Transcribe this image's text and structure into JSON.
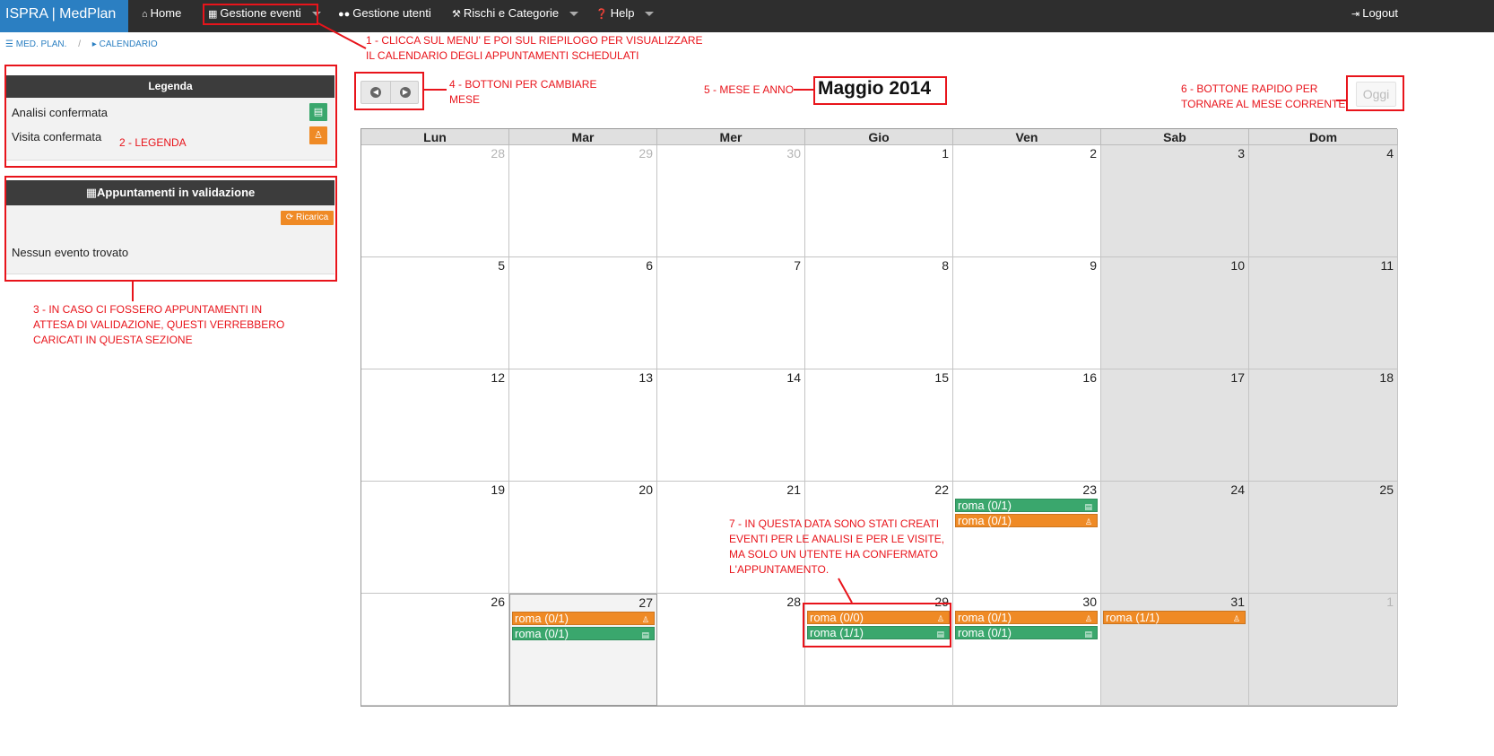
{
  "colors": {
    "brand": "#2b7fc2",
    "navbar": "#2e2e2e",
    "analisi": "#3aa76d",
    "visita": "#ef8a25",
    "annotation": "#e8141b"
  },
  "navbar": {
    "brand": "ISPRA | MedPlan",
    "items": [
      {
        "label": "Home",
        "icon": "home-icon"
      },
      {
        "label": "Gestione eventi",
        "icon": "calendar-icon",
        "dropdown": true
      },
      {
        "label": "Gestione utenti",
        "icon": "users-icon"
      },
      {
        "label": "Rischi e Categorie",
        "icon": "wrench-icon",
        "dropdown": true
      },
      {
        "label": "Help",
        "icon": "question-icon",
        "dropdown": true
      }
    ],
    "logout": "Logout"
  },
  "breadcrumb": {
    "root": "MED. PLAN.",
    "current": "CALENDARIO"
  },
  "legend": {
    "title": "Legenda",
    "items": [
      {
        "label": "Analisi confermata",
        "icon": "clipboard-icon"
      },
      {
        "label": "Visita confermata",
        "icon": "user-md-icon"
      }
    ]
  },
  "validation": {
    "title": "Appuntamenti in validazione",
    "reload": "Ricarica",
    "empty": "Nessun evento trovato"
  },
  "calendar": {
    "month_title": "Maggio 2014",
    "today_label": "Oggi",
    "weekdays": [
      "Lun",
      "Mar",
      "Mer",
      "Gio",
      "Ven",
      "Sab",
      "Dom"
    ],
    "weeks": [
      [
        "28",
        "29",
        "30",
        "1",
        "2",
        "3",
        "4"
      ],
      [
        "5",
        "6",
        "7",
        "8",
        "9",
        "10",
        "11"
      ],
      [
        "12",
        "13",
        "14",
        "15",
        "16",
        "17",
        "18"
      ],
      [
        "19",
        "20",
        "21",
        "22",
        "23",
        "24",
        "25"
      ],
      [
        "26",
        "27",
        "28",
        "29",
        "30",
        "31",
        "1"
      ]
    ],
    "events": {
      "23": [
        {
          "label": "roma (0/1)",
          "type": "analisi"
        },
        {
          "label": "roma (0/1)",
          "type": "visita"
        }
      ],
      "27": [
        {
          "label": "roma (0/1)",
          "type": "visita"
        },
        {
          "label": "roma (0/1)",
          "type": "analisi"
        }
      ],
      "29": [
        {
          "label": "roma (0/0)",
          "type": "visita"
        },
        {
          "label": "roma (1/1)",
          "type": "analisi"
        }
      ],
      "30": [
        {
          "label": "roma (0/1)",
          "type": "visita"
        },
        {
          "label": "roma (0/1)",
          "type": "analisi"
        }
      ],
      "31": [
        {
          "label": "roma (1/1)",
          "type": "visita"
        }
      ]
    }
  },
  "annotations": {
    "a1": [
      "1 - CLICCA SUL MENU' E POI SUL RIEPILOGO PER VISUALIZZARE",
      "IL CALENDARIO DEGLI APPUNTAMENTI SCHEDULATI"
    ],
    "a2": "2 - LEGENDA",
    "a3": [
      "3 - IN CASO CI FOSSERO APPUNTAMENTI IN",
      "ATTESA DI VALIDAZIONE, QUESTI VERREBBERO",
      "CARICATI IN QUESTA SEZIONE"
    ],
    "a4": [
      "4 - BOTTONI PER CAMBIARE",
      "MESE"
    ],
    "a5": "5 - MESE E ANNO",
    "a6": [
      "6 - BOTTONE RAPIDO PER",
      "TORNARE AL MESE CORRENTE"
    ],
    "a7": [
      "7 - IN QUESTA DATA SONO STATI CREATI",
      "EVENTI PER LE ANALISI E PER LE VISITE,",
      "MA SOLO UN UTENTE HA CONFERMATO",
      "L'APPUNTAMENTO."
    ]
  }
}
